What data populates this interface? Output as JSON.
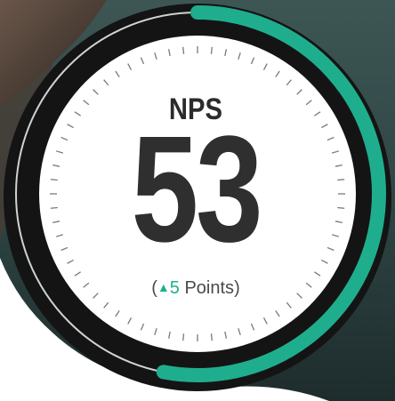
{
  "metric": {
    "label": "NPS",
    "value": "53",
    "change": {
      "open_paren": "(",
      "arrow": "▲",
      "amount": "5",
      "unit": "Points",
      "close_paren": ")"
    },
    "progress_fraction": 0.53
  },
  "colors": {
    "accent": "#1fae8d",
    "text_dark": "#2f2f2f",
    "dial_face": "#ffffff",
    "dial_ring": "#1a1a1a"
  },
  "icons": {
    "change_arrow": "triangle-up-icon"
  }
}
